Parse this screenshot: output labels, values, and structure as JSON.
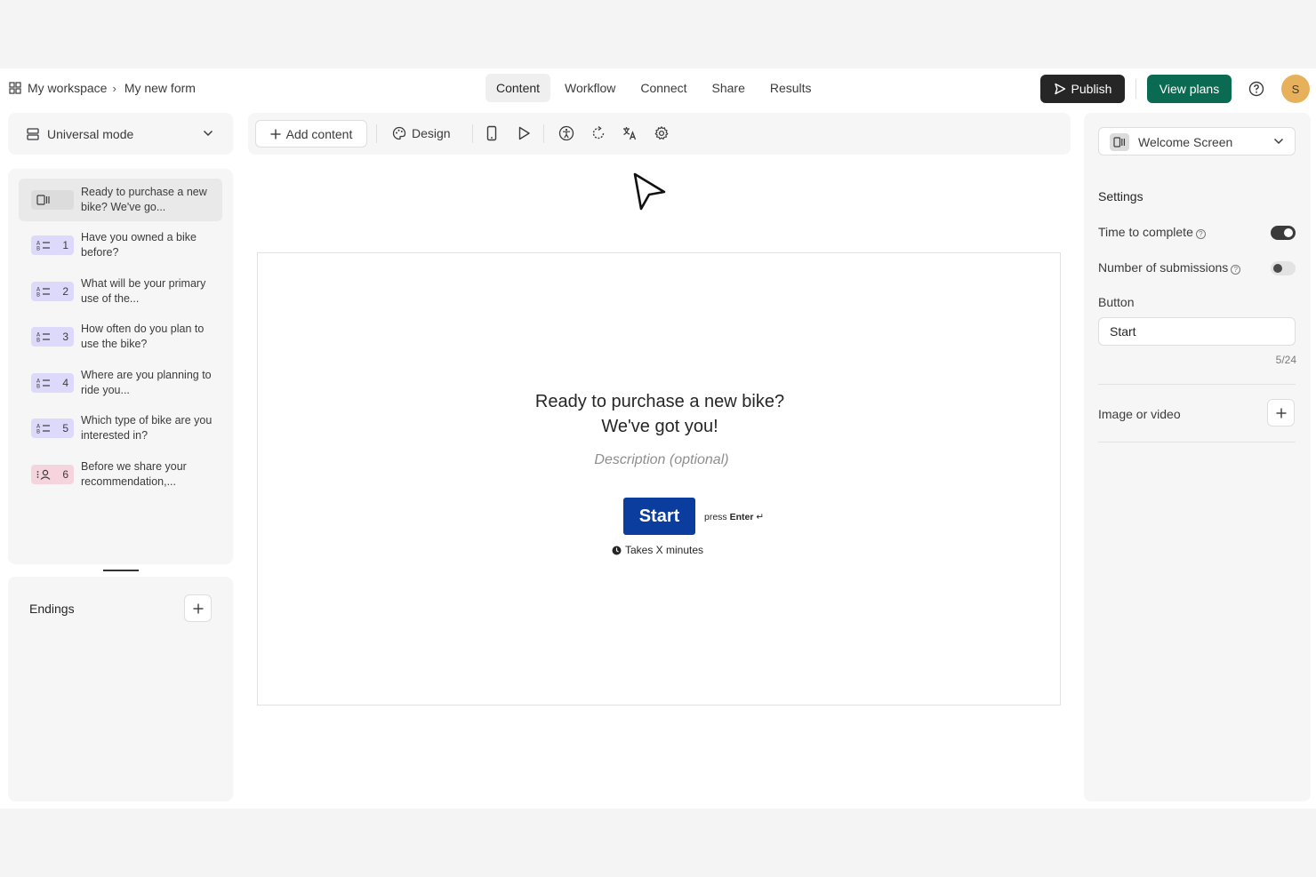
{
  "breadcrumb": {
    "workspace": "My workspace",
    "separator": "›",
    "form": "My new form"
  },
  "tabs": [
    {
      "label": "Content",
      "active": true
    },
    {
      "label": "Workflow",
      "active": false
    },
    {
      "label": "Connect",
      "active": false
    },
    {
      "label": "Share",
      "active": false
    },
    {
      "label": "Results",
      "active": false
    }
  ],
  "actions": {
    "publish": "Publish",
    "view_plans": "View plans",
    "avatar_initial": "S"
  },
  "colors": {
    "publish_bg": "#262627",
    "view_plans_bg": "#0b6b52",
    "start_button_bg": "#0a3d9e",
    "avatar_bg": "#e7b15c"
  },
  "left": {
    "mode": "Universal mode",
    "questions": [
      {
        "badge": "",
        "type": "welcome",
        "text": "Ready to purchase a new bike? We've go..."
      },
      {
        "badge": "1",
        "type": "multiple-choice",
        "text": "Have you owned a bike before?"
      },
      {
        "badge": "2",
        "type": "multiple-choice",
        "text": "What will be your primary use of the..."
      },
      {
        "badge": "3",
        "type": "multiple-choice",
        "text": "How often do you plan to use the bike?"
      },
      {
        "badge": "4",
        "type": "multiple-choice",
        "text": "Where are you planning to ride you..."
      },
      {
        "badge": "5",
        "type": "multiple-choice",
        "text": "Which type of bike are you interested in?"
      },
      {
        "badge": "6",
        "type": "contact",
        "text": "Before we share your recommendation,..."
      }
    ],
    "endings_label": "Endings"
  },
  "toolbar": {
    "add_content": "Add content",
    "design": "Design"
  },
  "canvas": {
    "title_line1": "Ready to purchase a new bike?",
    "title_line2": "We've got you!",
    "description_placeholder": "Description (optional)",
    "start_label": "Start",
    "press": "press",
    "enter": "Enter",
    "enter_glyph": "↵",
    "takes": "Takes X minutes"
  },
  "right": {
    "screen_select": "Welcome Screen",
    "settings_label": "Settings",
    "time_to_complete": "Time to complete",
    "time_to_complete_on": true,
    "number_of_submissions": "Number of submissions",
    "number_of_submissions_on": false,
    "button_label": "Button",
    "button_value": "Start",
    "button_counter": "5/24",
    "image_or_video": "Image or video"
  }
}
